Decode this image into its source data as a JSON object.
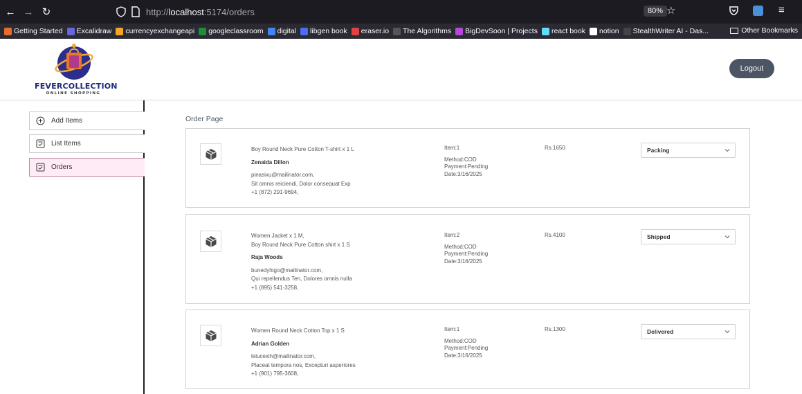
{
  "browser": {
    "url_scheme": "http://",
    "url_host": "localhost",
    "url_path": ":5174/orders",
    "zoom": "80%",
    "bookmarks": [
      "Getting Started",
      "Excalidraw",
      "currencyexchangeapi",
      "googleclassroom",
      "digital",
      "libgen book",
      "eraser.io",
      "The Algorithms",
      "BigDevSoon | Projects",
      "react book",
      "notion",
      "StealthWriter AI - Das..."
    ],
    "bookmark_colors": [
      "#e86d2a",
      "#6965db",
      "#f5a623",
      "#1e8e3e",
      "#4285f4",
      "#4a6cf7",
      "#e0433f",
      "#555555",
      "#b14bd6",
      "#61dafb",
      "#ffffff",
      "#444444"
    ],
    "other_bookmarks": "Other Bookmarks"
  },
  "header": {
    "logo_text": "FEVERCOLLECTION",
    "logo_sub": "ONLINE SHOPPING",
    "logout_label": "Logout"
  },
  "sidebar": {
    "items": [
      {
        "label": "Add Items",
        "icon": "plus-circle-icon"
      },
      {
        "label": "List Items",
        "icon": "checklist-icon"
      },
      {
        "label": "Orders",
        "icon": "checklist-icon"
      }
    ],
    "active_index": 2
  },
  "main": {
    "title": "Order Page",
    "orders": [
      {
        "items": [
          "Boy Round Neck Pure Cotton T-shirt x 1 L"
        ],
        "name": "Zenaida Dillon",
        "email": "pinasixu@mailinator.com,",
        "address": "Sit omnis reiciendi, Dolor consequat Exp",
        "phone": "+1 (872) 291-9694,",
        "item_count": "Item:1",
        "method": "Method:COD",
        "payment": "Payment:Pending",
        "date": "Date:3/16/2025",
        "amount": "Rs.1650",
        "status": "Packing"
      },
      {
        "items": [
          "Women Jacket x 1 M,",
          "Boy Round Neck Pure Cotton shirt x 1 S"
        ],
        "name": "Raja Woods",
        "email": "bunedyhigo@mailinator.com,",
        "address": "Qui repellendus Ten, Dolores omnis nulla",
        "phone": "+1 (895) 541-3258,",
        "item_count": "Item:2",
        "method": "Method:COD",
        "payment": "Payment:Pending",
        "date": "Date:3/16/2025",
        "amount": "Rs.4100",
        "status": "Shipped"
      },
      {
        "items": [
          "Women Round Neck Cotton Top x 1 S"
        ],
        "name": "Adrian Golden",
        "email": "lelucexih@mailinator.com,",
        "address": "Placeat tempora nos, Excepturi asperiores",
        "phone": "+1 (901) 795-3608,",
        "item_count": "Item:1",
        "method": "Method:COD",
        "payment": "Payment:Pending",
        "date": "Date:3/16/2025",
        "amount": "Rs.1300",
        "status": "Delivered"
      }
    ]
  }
}
